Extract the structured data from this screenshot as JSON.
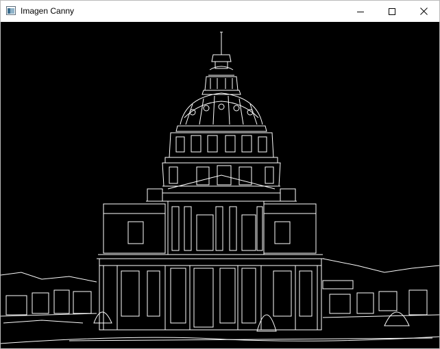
{
  "window": {
    "title": "Imagen Canny",
    "icon": "app-window-icon",
    "controls": [
      "minimize-icon",
      "maximize-icon",
      "close-icon"
    ]
  },
  "image": {
    "description_icon": "canny-edge-image",
    "background_color": "#000000",
    "edge_color": "#ffffff"
  }
}
